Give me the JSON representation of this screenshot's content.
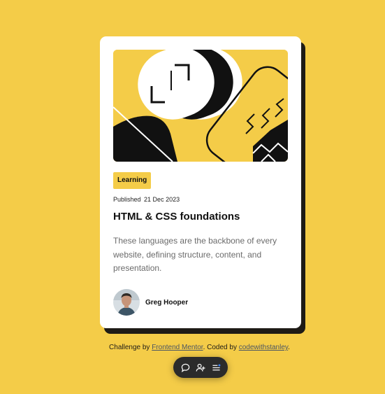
{
  "card": {
    "tag": "Learning",
    "published_label": "Published",
    "published_date": "21 Dec 2023",
    "title": "HTML & CSS foundations",
    "description": "These languages are the backbone of every website, defining structure, content, and presentation.",
    "author": "Greg Hooper"
  },
  "attribution": {
    "prefix": "Challenge by ",
    "link1": "Frontend Mentor",
    "middle": ". Coded by ",
    "link2": "codewithstanley",
    "suffix": "."
  },
  "toolbar": {
    "icons": [
      "comment-icon",
      "add-user-icon",
      "menu-icon"
    ]
  },
  "colors": {
    "background": "#F4CC48",
    "card": "#FFFFFF",
    "shadow": "#1E1B16",
    "text": "#111111",
    "muted": "#6B6B6B"
  }
}
